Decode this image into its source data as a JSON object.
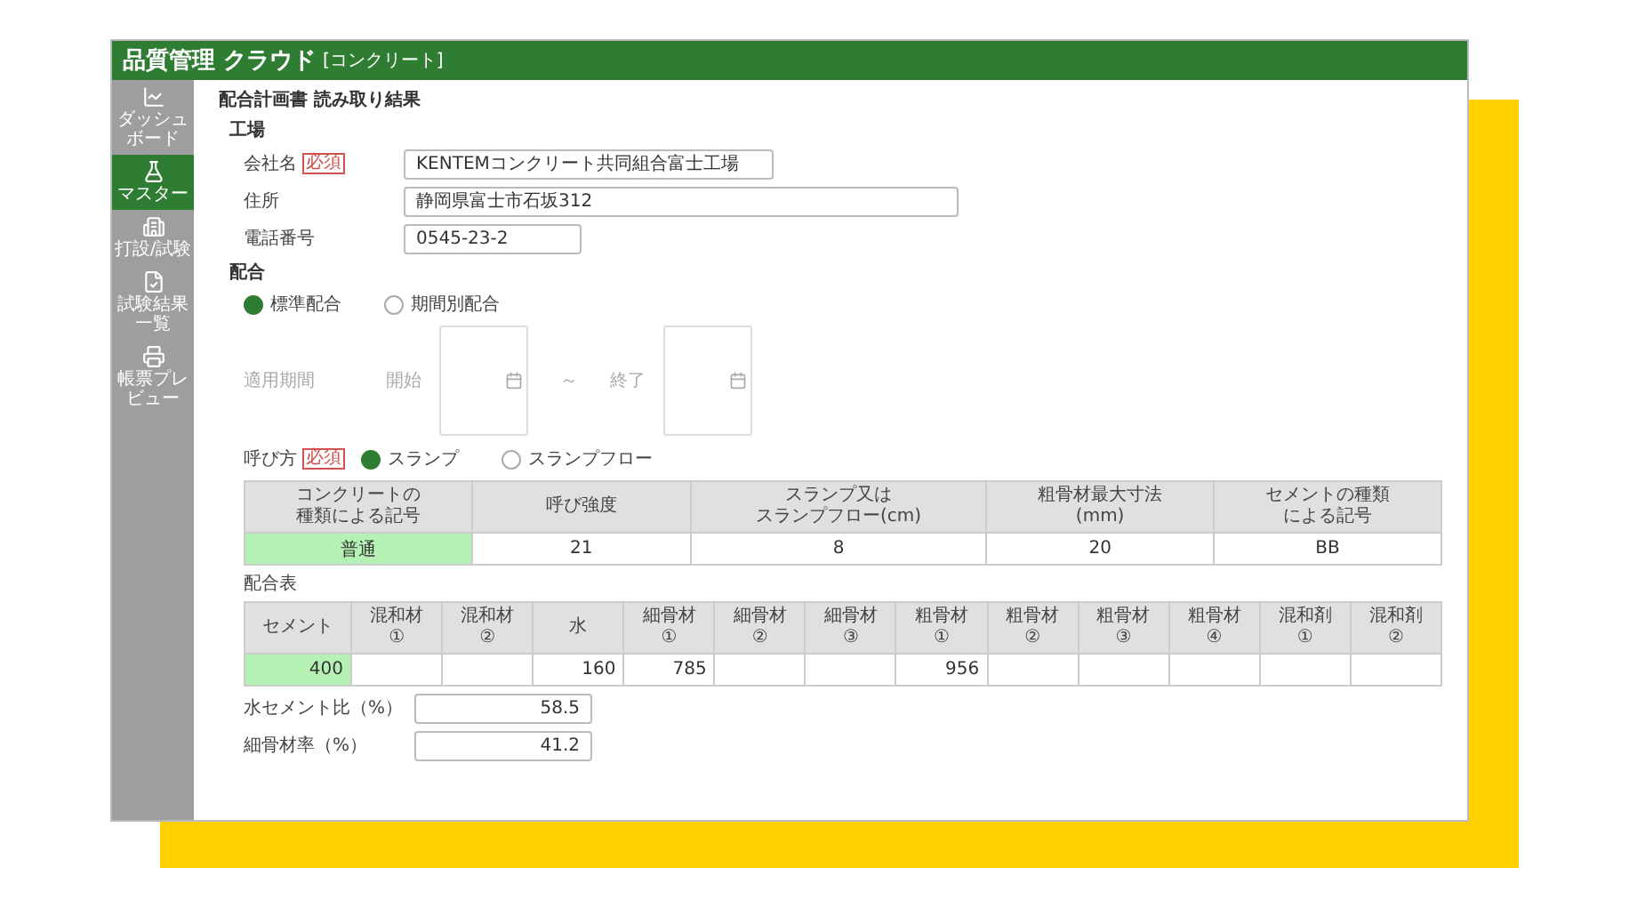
{
  "app": {
    "title": "品質管理 クラウド",
    "subtitle": "[コンクリート]"
  },
  "sidebar": {
    "items": [
      {
        "label": "ダッシュボード",
        "selected": false
      },
      {
        "label": "マスター",
        "selected": true
      },
      {
        "label": "打設/試験",
        "selected": false
      },
      {
        "label": "試験結果一覧",
        "selected": false
      },
      {
        "label": "帳票プレビュー",
        "selected": false
      }
    ]
  },
  "page_title": "配合計画書 読み取り結果",
  "plant": {
    "heading": "工場",
    "fields": [
      {
        "label": "会社名",
        "required": true,
        "required_label": "必須",
        "value": "KENTEMコンクリート共同組合富士工場"
      },
      {
        "label": "住所",
        "required": false,
        "value": "静岡県富士市石坂312"
      },
      {
        "label": "電話番号",
        "required": false,
        "value": "0545-23-2"
      }
    ]
  },
  "mix": {
    "heading": "配合",
    "options": [
      {
        "label": "標準配合",
        "selected": true
      },
      {
        "label": "期間別配合",
        "selected": false
      }
    ],
    "period": {
      "label": "適用期間",
      "start_label": "開始",
      "separator": "～",
      "end_label": "終了",
      "disabled": true
    }
  },
  "designation": {
    "label": "呼び方",
    "required": true,
    "required_label": "必須",
    "options": [
      {
        "label": "スランプ",
        "selected": true
      },
      {
        "label": "スランプフロー",
        "selected": false
      }
    ]
  },
  "spec_table": {
    "columns": [
      {
        "lines": [
          "コンクリートの",
          "種類による記号"
        ]
      },
      {
        "lines": [
          "呼び強度"
        ]
      },
      {
        "lines": [
          "スランプ又は",
          "スランプフロー(cm)"
        ]
      },
      {
        "lines": [
          "粗骨材最大寸法",
          "(mm)"
        ]
      },
      {
        "lines": [
          "セメントの種類",
          "による記号"
        ]
      }
    ],
    "rows": [
      {
        "cells": [
          {
            "text": "普通",
            "highlighted": true
          },
          {
            "text": "21",
            "highlighted": false
          },
          {
            "text": "8",
            "highlighted": false
          },
          {
            "text": "20",
            "highlighted": false
          },
          {
            "text": "BB",
            "highlighted": false
          }
        ]
      }
    ]
  },
  "mix_table": {
    "heading": "配合表",
    "columns": [
      {
        "name": "セメント"
      },
      {
        "name": "混和材",
        "sub": "①"
      },
      {
        "name": "混和材",
        "sub": "②"
      },
      {
        "name": "水"
      },
      {
        "name": "細骨材",
        "sub": "①"
      },
      {
        "name": "細骨材",
        "sub": "②"
      },
      {
        "name": "細骨材",
        "sub": "③"
      },
      {
        "name": "粗骨材",
        "sub": "①"
      },
      {
        "name": "粗骨材",
        "sub": "②"
      },
      {
        "name": "粗骨材",
        "sub": "③"
      },
      {
        "name": "粗骨材",
        "sub": "④"
      },
      {
        "name": "混和剤",
        "sub": "①"
      },
      {
        "name": "混和剤",
        "sub": "②"
      }
    ],
    "rows": [
      {
        "cells": [
          {
            "text": "400",
            "highlighted": true
          },
          {
            "highlighted": false
          },
          {
            "highlighted": false
          },
          {
            "text": "160",
            "highlighted": false
          },
          {
            "text": "785",
            "highlighted": false
          },
          {
            "highlighted": false
          },
          {
            "highlighted": false
          },
          {
            "text": "956",
            "highlighted": false
          },
          {
            "highlighted": false
          },
          {
            "highlighted": false
          },
          {
            "highlighted": false
          },
          {
            "highlighted": false
          },
          {
            "highlighted": false
          }
        ]
      }
    ]
  },
  "ratios": [
    {
      "label": "水セメント比（%）",
      "value": "58.5"
    },
    {
      "label": "細骨材率（%）",
      "value": "41.2"
    }
  ]
}
